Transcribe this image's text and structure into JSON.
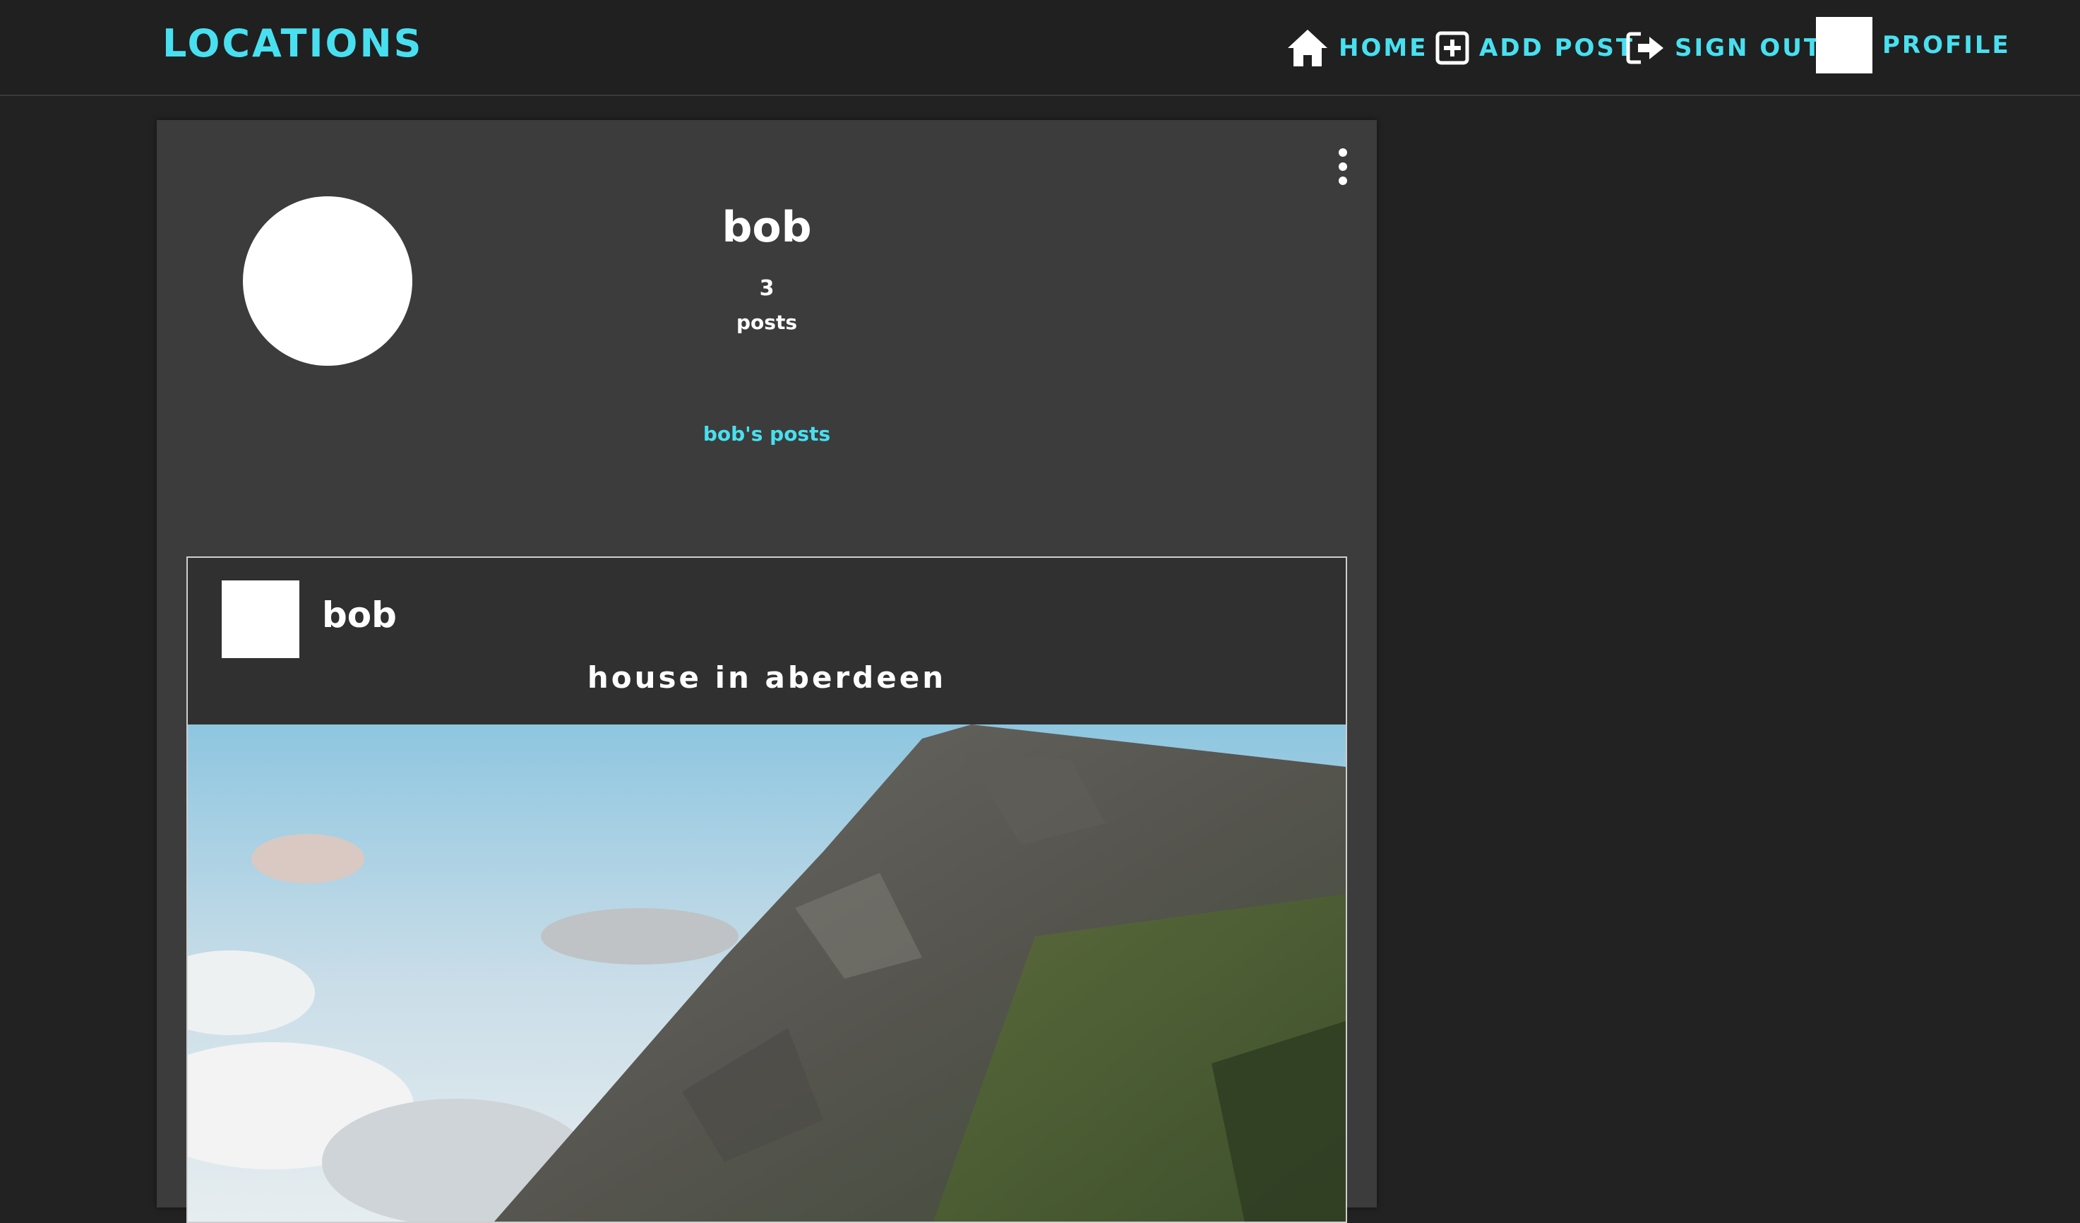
{
  "navbar": {
    "brand": "LOCATIONS",
    "items": [
      {
        "label": "HOME",
        "icon": "home-icon"
      },
      {
        "label": "ADD POST",
        "icon": "plus-square-icon"
      },
      {
        "label": "SIGN OUT",
        "icon": "sign-out-icon"
      },
      {
        "label": "PROFILE",
        "icon": "profile-avatar"
      }
    ]
  },
  "profile": {
    "username": "bob",
    "post_count": "3",
    "post_count_label": "posts",
    "posts_link": "bob's posts",
    "menu_icon": "more-vertical-icon"
  },
  "post": {
    "author": "bob",
    "title": "house in aberdeen",
    "image": "mountain-landscape-photo"
  },
  "colors": {
    "accent": "#48e0f0",
    "background": "#222222",
    "card": "#3c3c3c",
    "post_header": "#303030"
  }
}
